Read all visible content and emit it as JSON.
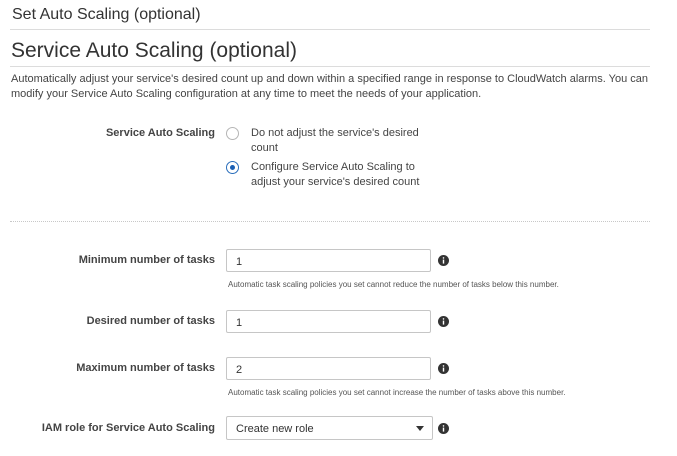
{
  "page": {
    "title": "Set Auto Scaling (optional)"
  },
  "section": {
    "title": "Service Auto Scaling (optional)",
    "description": "Automatically adjust your service's desired count up and down within a specified range in response to CloudWatch alarms. You can modify your Service Auto Scaling configuration at any time to meet the needs of your application."
  },
  "service_auto_scaling": {
    "label": "Service Auto Scaling",
    "options": [
      {
        "label": "Do not adjust the service's desired count",
        "selected": false
      },
      {
        "label": "Configure Service Auto Scaling to adjust your service's desired count",
        "selected": true
      }
    ]
  },
  "fields": {
    "min_tasks": {
      "label": "Minimum number of tasks",
      "value": "1",
      "help": "Automatic task scaling policies you set cannot reduce the number of tasks below this number."
    },
    "desired_tasks": {
      "label": "Desired number of tasks",
      "value": "1"
    },
    "max_tasks": {
      "label": "Maximum number of tasks",
      "value": "2",
      "help": "Automatic task scaling policies you set cannot increase the number of tasks above this number."
    },
    "iam_role": {
      "label": "IAM role for Service Auto Scaling",
      "value": "Create new role"
    }
  },
  "icons": {
    "info": "info-icon",
    "dropdown": "chevron-down-icon"
  },
  "colors": {
    "accent": "#1a5fb4",
    "text": "#333333",
    "border": "#c6c6c6"
  }
}
